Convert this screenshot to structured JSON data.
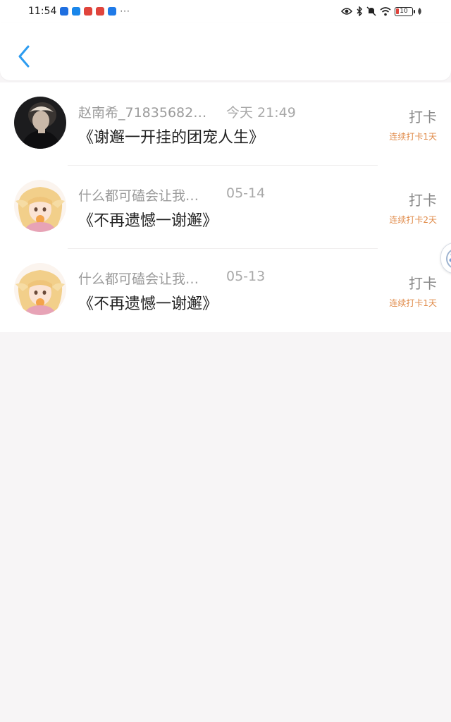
{
  "status_bar": {
    "time": "11:54",
    "overflow": "···",
    "battery": "10",
    "icons": [
      "app-notification-icon-1",
      "app-notification-icon-2",
      "app-notification-icon-3",
      "app-notification-icon-4",
      "app-notification-icon-5",
      "eye-icon",
      "bluetooth-icon",
      "mute-icon",
      "wifi-icon",
      "battery-icon",
      "leaf-icon"
    ]
  },
  "header": {
    "back_icon": "chevron-left-icon",
    "accent_color": "#2d9cf0"
  },
  "entries": [
    {
      "name": "赵南希_71835682…",
      "time": "今天 21:49",
      "title": "《谢邂一开挂的团宠人生》",
      "action": "打卡",
      "streak": "连续打卡1天",
      "avatar": "dark-photo-avatar"
    },
    {
      "name": "什么都可磕会让我…",
      "time": "05-14",
      "title": "《不再遗憾一谢邂》",
      "action": "打卡",
      "streak": "连续打卡2天",
      "avatar": "anime-girl-avatar"
    },
    {
      "name": "什么都可磕会让我…",
      "time": "05-13",
      "title": "《不再遗憾一谢邂》",
      "action": "打卡",
      "streak": "连续打卡1天",
      "avatar": "anime-girl-avatar"
    }
  ],
  "colors": {
    "streak": "#e08a48",
    "background": "#f7f5f6"
  }
}
